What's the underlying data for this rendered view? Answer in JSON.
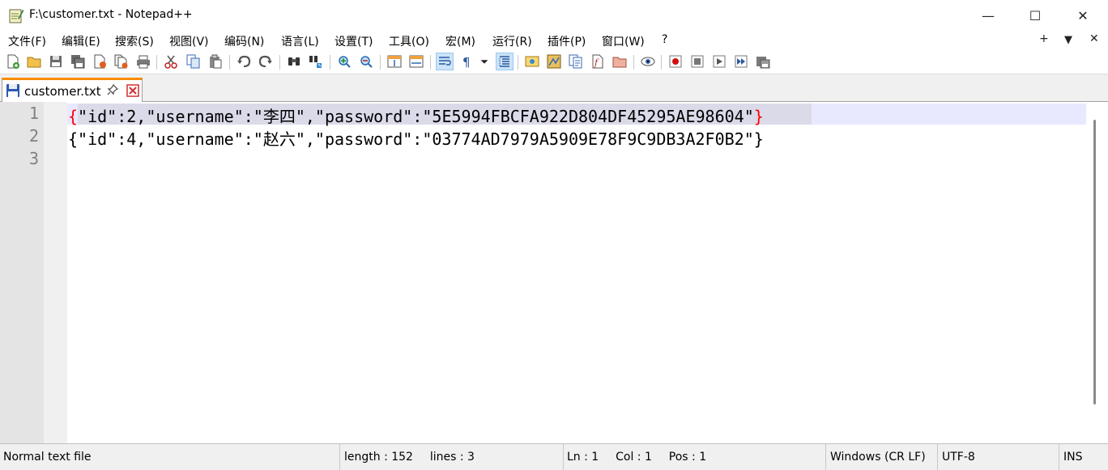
{
  "window": {
    "title": "F:\\customer.txt - Notepad++",
    "min_glyph": "—",
    "max_glyph": "☐",
    "close_glyph": "✕"
  },
  "menu": {
    "items": [
      "文件(F)",
      "编辑(E)",
      "搜索(S)",
      "视图(V)",
      "编码(N)",
      "语言(L)",
      "设置(T)",
      "工具(O)",
      "宏(M)",
      "运行(R)",
      "插件(P)",
      "窗口(W)",
      "?"
    ],
    "extras": [
      "+",
      "▼",
      "✕"
    ]
  },
  "toolbar": {
    "icons": [
      "new-file-icon",
      "open-file-icon",
      "save-icon",
      "save-all-icon",
      "close-icon",
      "close-all-icon",
      "print-icon",
      "cut-icon",
      "copy-icon",
      "paste-icon",
      "undo-icon",
      "redo-icon",
      "find-icon",
      "replace-icon",
      "zoom-in-icon",
      "zoom-out-icon",
      "sync-v-icon",
      "sync-h-icon",
      "word-wrap-icon",
      "show-all-chars-icon",
      "dropdown-icon",
      "indent-guide-icon",
      "user-define-icon",
      "doc-map-icon",
      "doc-list-icon",
      "function-list-icon",
      "folder-workspace-icon",
      "monitor-icon",
      "record-macro-icon",
      "stop-macro-icon",
      "play-macro-icon",
      "play-multiple-icon",
      "save-macro-icon"
    ]
  },
  "tab": {
    "label": "customer.txt",
    "pin_glyph": "✈"
  },
  "editor": {
    "line_numbers": [
      "1",
      "2",
      "3"
    ],
    "lines": [
      {
        "open_brace": "{",
        "body": "\"id\":2,\"username\":\"李四\",\"password\":\"5E5994FBCFA922D804DF45295AE98604\"",
        "close_brace": "}"
      },
      {
        "text": "{\"id\":4,\"username\":\"赵六\",\"password\":\"03774AD7979A5909E78F9C9DB3A2F0B2\"}"
      },
      {
        "text": ""
      }
    ]
  },
  "status": {
    "file_type": "Normal text file",
    "length": "length : 152",
    "lines": "lines : 3",
    "ln": "Ln : 1",
    "col": "Col : 1",
    "pos": "Pos : 1",
    "eol": "Windows (CR LF)",
    "encoding": "UTF-8",
    "mode": "INS"
  },
  "colors": {
    "tab_accent": "#fa8c00",
    "brace_match": "#ff0000",
    "current_line": "#e8e8ff"
  }
}
